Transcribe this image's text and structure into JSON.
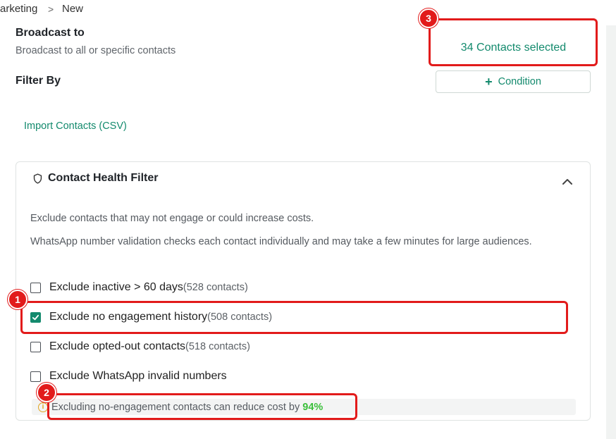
{
  "breadcrumb": {
    "parent": "arketing",
    "current": "New"
  },
  "broadcast": {
    "title": "Broadcast to",
    "subtitle": "Broadcast to all or specific contacts",
    "selected_label": "34 Contacts selected"
  },
  "filter": {
    "label": "Filter By",
    "condition_button": "Condition"
  },
  "import_label": "Import Contacts (CSV)",
  "health_filter": {
    "title": "Contact Health Filter",
    "desc1": "Exclude contacts that may not engage or could increase costs.",
    "desc2": "WhatsApp number validation checks each contact individually and may take a few minutes for large audiences.",
    "options": [
      {
        "label": "Exclude inactive > 60 days",
        "count": "(528 contacts)",
        "checked": false
      },
      {
        "label": "Exclude no engagement history",
        "count": "(508 contacts)",
        "checked": true
      },
      {
        "label": "Exclude opted-out contacts",
        "count": "(518 contacts)",
        "checked": false
      },
      {
        "label": "Exclude WhatsApp invalid numbers",
        "count": "",
        "checked": false
      }
    ],
    "hint_text": "Excluding no-engagement contacts can reduce cost by",
    "hint_pct": "94%"
  },
  "annotations": [
    "1",
    "2",
    "3"
  ],
  "colors": {
    "accent": "#138a6d",
    "annotation": "#e21b1b",
    "savings": "#3bbf3b"
  }
}
